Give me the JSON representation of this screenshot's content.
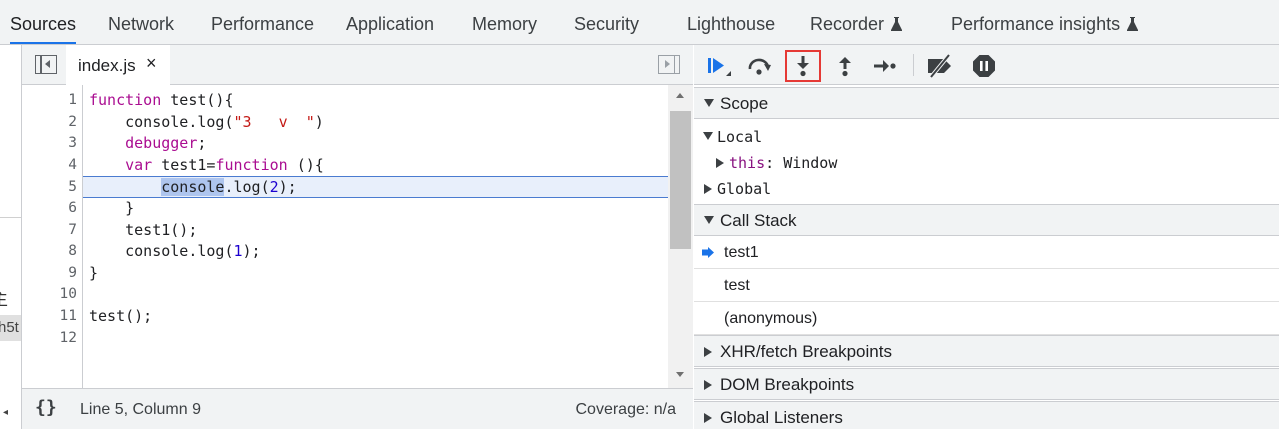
{
  "top_tabs": [
    {
      "label": "Sources",
      "active": true
    },
    {
      "label": "Network"
    },
    {
      "label": "Performance"
    },
    {
      "label": "Application"
    },
    {
      "label": "Memory"
    },
    {
      "label": "Security"
    },
    {
      "label": "Lighthouse"
    },
    {
      "label": "Recorder",
      "icon": "flask-icon"
    },
    {
      "label": "Performance insights",
      "icon": "flask-icon"
    }
  ],
  "left_panel": {
    "fragment_1": "主",
    "fragment_2": "h5t",
    "fragment_3": "◂"
  },
  "editor": {
    "file_tab": {
      "name": "index.js",
      "close": "×"
    },
    "lines": [
      {
        "n": "1"
      },
      {
        "n": "2"
      },
      {
        "n": "3"
      },
      {
        "n": "4"
      },
      {
        "n": "5"
      },
      {
        "n": "6"
      },
      {
        "n": "7"
      },
      {
        "n": "8"
      },
      {
        "n": "9"
      },
      {
        "n": "10"
      },
      {
        "n": "11"
      },
      {
        "n": "12"
      }
    ],
    "code": {
      "l1_kw": "function",
      "l1_rest": " test(){",
      "l2_a": "    console.log(",
      "l2_str": "\"3   v  \"",
      "l2_b": ")",
      "l3_kw": "    debugger",
      "l3_b": ";",
      "l4_kw": "    var",
      "l4_b": " test1=",
      "l4_kw2": "function",
      "l4_c": " (){",
      "l5_indent": "        ",
      "l5_sel": "console",
      "l5_b": ".log(",
      "l5_num": "2",
      "l5_c": ");",
      "l6": "    }",
      "l7": "    test1();",
      "l8_a": "    console.log(",
      "l8_num": "1",
      "l8_b": ");",
      "l9": "}",
      "l10": "",
      "l11": "test();",
      "l12": ""
    },
    "highlighted_line": 5,
    "status": {
      "braces": "{}",
      "position": "Line 5, Column 9",
      "coverage": "Coverage: n/a"
    }
  },
  "debugger": {
    "toolbar": [
      {
        "name": "resume-icon"
      },
      {
        "name": "step-over-icon"
      },
      {
        "name": "step-into-icon",
        "highlighted": true
      },
      {
        "name": "step-out-icon"
      },
      {
        "name": "step-icon"
      },
      {
        "name": "deactivate-breakpoints-icon"
      },
      {
        "name": "pause-on-exceptions-icon"
      }
    ],
    "scope": {
      "title": "Scope",
      "local": "Local",
      "this_key": "this",
      "this_sep": ": ",
      "this_val": "Window",
      "global": "Global"
    },
    "call_stack": {
      "title": "Call Stack",
      "frames": [
        "test1",
        "test",
        "(anonymous)"
      ],
      "current": 0
    },
    "sections": {
      "xhr": "XHR/fetch Breakpoints",
      "dom": "DOM Breakpoints",
      "global_listeners": "Global Listeners"
    },
    "colors": {
      "accent": "#1a73e8",
      "highlight_box": "#e53935",
      "line_highlight": "#e8effb"
    }
  }
}
